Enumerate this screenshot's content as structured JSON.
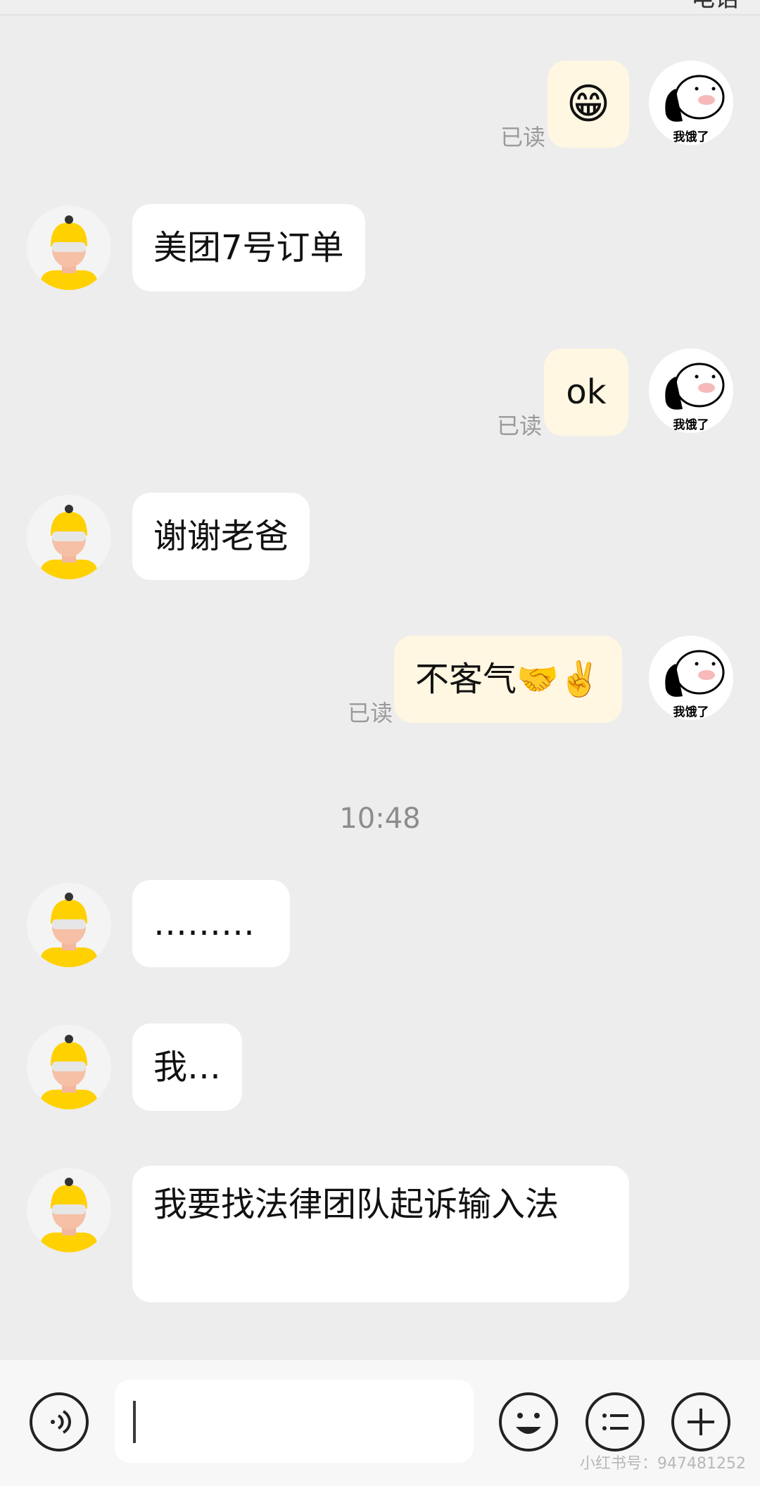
{
  "header": {
    "partial_text": "电话"
  },
  "messages": [
    {
      "side": "right",
      "type": "emoji",
      "emoji": "😁",
      "read_label": "已读"
    },
    {
      "side": "left",
      "text": "美团7号订单"
    },
    {
      "side": "right",
      "text": "ok",
      "read_label": "已读"
    },
    {
      "side": "left",
      "text": "谢谢老爸"
    },
    {
      "side": "right",
      "text": "不客气🤝✌️",
      "read_label": "已读"
    },
    {
      "side": "left",
      "text": "………"
    },
    {
      "side": "left",
      "text": "我…"
    },
    {
      "side": "left",
      "text": "我要找法律团队起诉输入法"
    }
  ],
  "timestamp": "10:48",
  "self_avatar": {
    "caption": "我饿了",
    "icon": "hungry-sticker-avatar"
  },
  "courier_avatar": {
    "icon": "yellow-helmet-courier-avatar"
  },
  "input_bar": {
    "input_value": "",
    "icons": [
      "voice-icon",
      "emoji-icon",
      "list-icon",
      "plus-icon"
    ]
  },
  "watermark": "小红书号：947481252",
  "colors": {
    "bg": "#ededed",
    "my_bubble": "#fff7e2",
    "other_bubble": "#ffffff",
    "helmet": "#ffd100"
  }
}
